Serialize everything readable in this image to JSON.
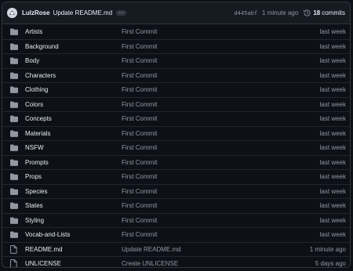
{
  "header": {
    "author": "LulzRose",
    "message": "Update README.md",
    "ellipsis": "···",
    "sha": "d445abf",
    "time": "1 minute ago",
    "commits_count": "18",
    "commits_label": "commits"
  },
  "rows": [
    {
      "name": "Artists",
      "icon": "folder-icon",
      "commit": "First Commit",
      "date": "last week"
    },
    {
      "name": "Background",
      "icon": "folder-icon",
      "commit": "First Commit",
      "date": "last week"
    },
    {
      "name": "Body",
      "icon": "folder-icon",
      "commit": "First Commit",
      "date": "last week"
    },
    {
      "name": "Characters",
      "icon": "folder-icon",
      "commit": "First Commit",
      "date": "last week"
    },
    {
      "name": "Clothing",
      "icon": "folder-icon",
      "commit": "First Commit",
      "date": "last week"
    },
    {
      "name": "Colors",
      "icon": "folder-icon",
      "commit": "First Commit",
      "date": "last week"
    },
    {
      "name": "Concepts",
      "icon": "folder-icon",
      "commit": "First Commit",
      "date": "last week"
    },
    {
      "name": "Materials",
      "icon": "folder-icon",
      "commit": "First Commit",
      "date": "last week"
    },
    {
      "name": "NSFW",
      "icon": "folder-icon",
      "commit": "First Commit",
      "date": "last week"
    },
    {
      "name": "Prompts",
      "icon": "folder-icon",
      "commit": "First Commit",
      "date": "last week"
    },
    {
      "name": "Props",
      "icon": "folder-icon",
      "commit": "First Commit",
      "date": "last week"
    },
    {
      "name": "Species",
      "icon": "folder-icon",
      "commit": "First Commit",
      "date": "last week"
    },
    {
      "name": "States",
      "icon": "folder-icon",
      "commit": "First Commit",
      "date": "last week"
    },
    {
      "name": "Styling",
      "icon": "folder-icon",
      "commit": "First Commit",
      "date": "last week"
    },
    {
      "name": "Vocab-and-Lists",
      "icon": "folder-icon",
      "commit": "First Commit",
      "date": "last week"
    },
    {
      "name": "README.md",
      "icon": "file-icon",
      "commit": "Update README.md",
      "date": "1 minute ago"
    },
    {
      "name": "UNLICENSE",
      "icon": "file-icon",
      "commit": "Create UNLICENSE",
      "date": "5 days ago"
    }
  ],
  "colors": {
    "background": "#0d1117",
    "header_background": "#161b22",
    "border": "#30363d",
    "text": "#e6edf3",
    "muted": "#9198a1",
    "folder_icon": "#9198a1"
  }
}
